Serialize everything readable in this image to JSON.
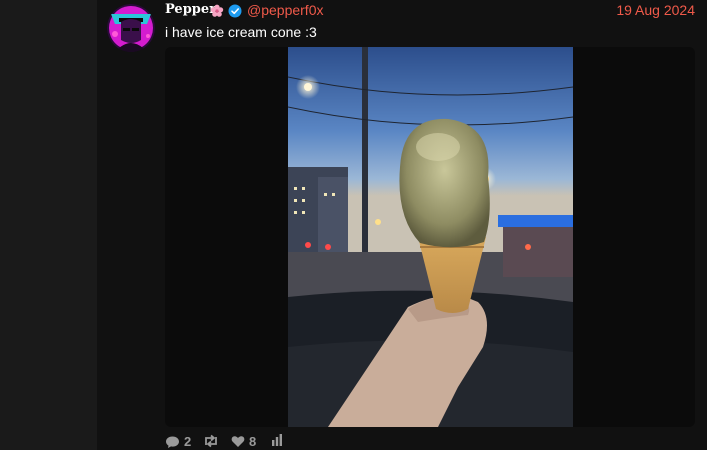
{
  "post": {
    "display_name": "Pepper",
    "handle": "@pepperf0x",
    "date": "19 Aug 2024",
    "text": "i have ice cream cone :3",
    "icons": {
      "flower": "sakura-flower-icon",
      "verified": "verified-badge-icon"
    },
    "colors": {
      "accent": "#f05a4a",
      "verified": "#1d9bf0",
      "background": "#111111"
    }
  },
  "actions": {
    "replies": "2",
    "likes": "8",
    "icons": [
      "reply-icon",
      "repost-icon",
      "like-icon",
      "stats-icon"
    ]
  }
}
